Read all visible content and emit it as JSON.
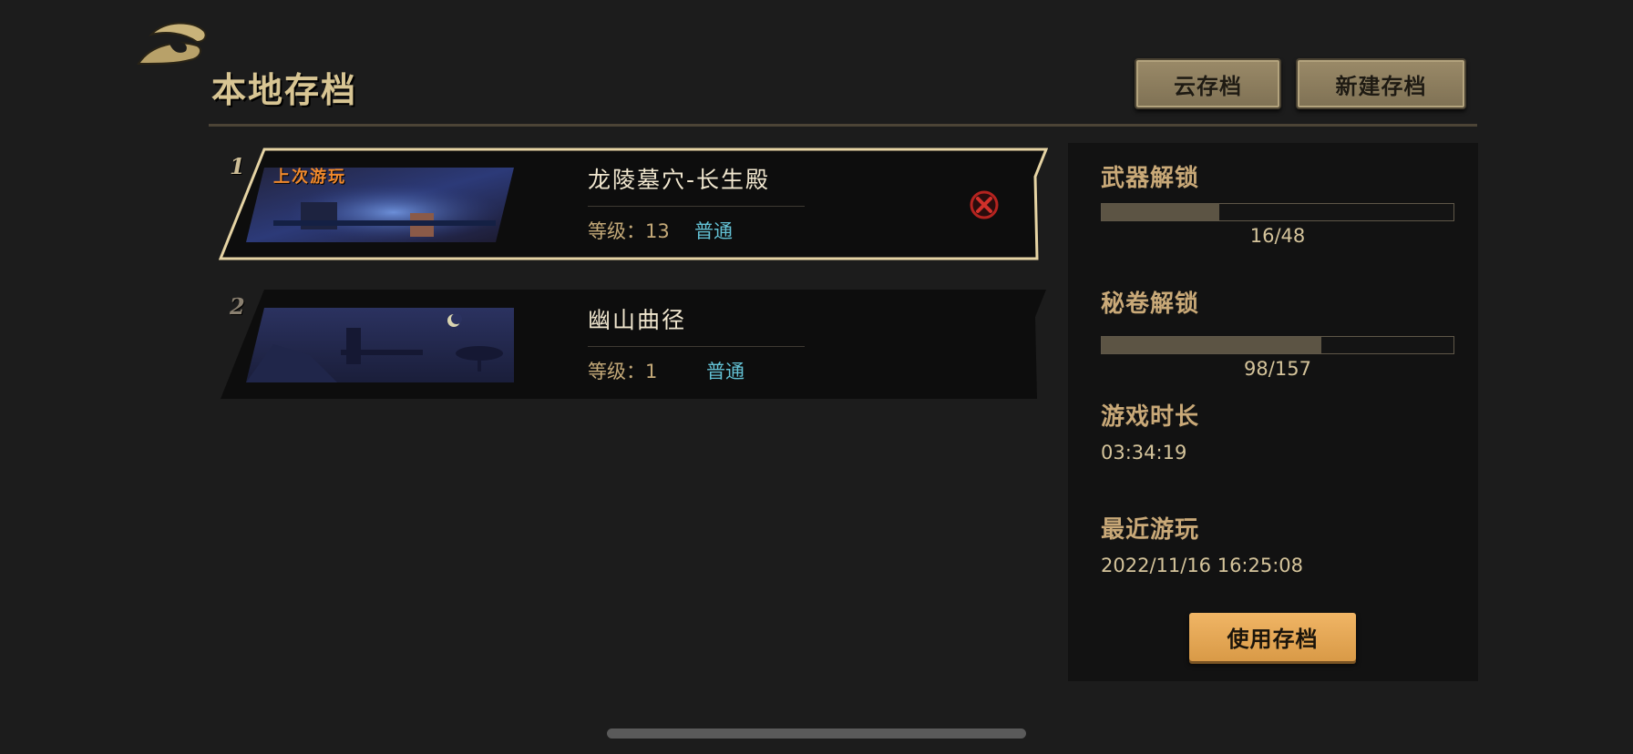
{
  "header": {
    "title": "本地存档",
    "cloud_save_label": "云存档",
    "new_save_label": "新建存档"
  },
  "slots": [
    {
      "number": "1",
      "tag": "上次游玩",
      "name": "龙陵墓穴-长生殿",
      "level": "等级：13",
      "mode": "普通",
      "selected": true
    },
    {
      "number": "2",
      "name": "幽山曲径",
      "level": "等级：1",
      "mode": "普通",
      "selected": false
    }
  ],
  "details": {
    "weapons_label": "武器解锁",
    "weapons_text": "16/48",
    "weapons_progress": 0.333,
    "scrolls_label": "秘卷解锁",
    "scrolls_text": "98/157",
    "scrolls_progress": 0.624,
    "playtime_label": "游戏时长",
    "playtime_value": "03:34:19",
    "last_played_label": "最近游玩",
    "last_played_value": "2022/11/16 16:25:08",
    "use_button_label": "使用存档"
  },
  "colors": {
    "accent_gold": "#d8c593",
    "mode_cyan": "#63c1d4",
    "last_played_orange": "#f0892c",
    "use_button": "#e8aa58"
  },
  "icons": {
    "back": "back-icon",
    "delete": "close-icon"
  }
}
